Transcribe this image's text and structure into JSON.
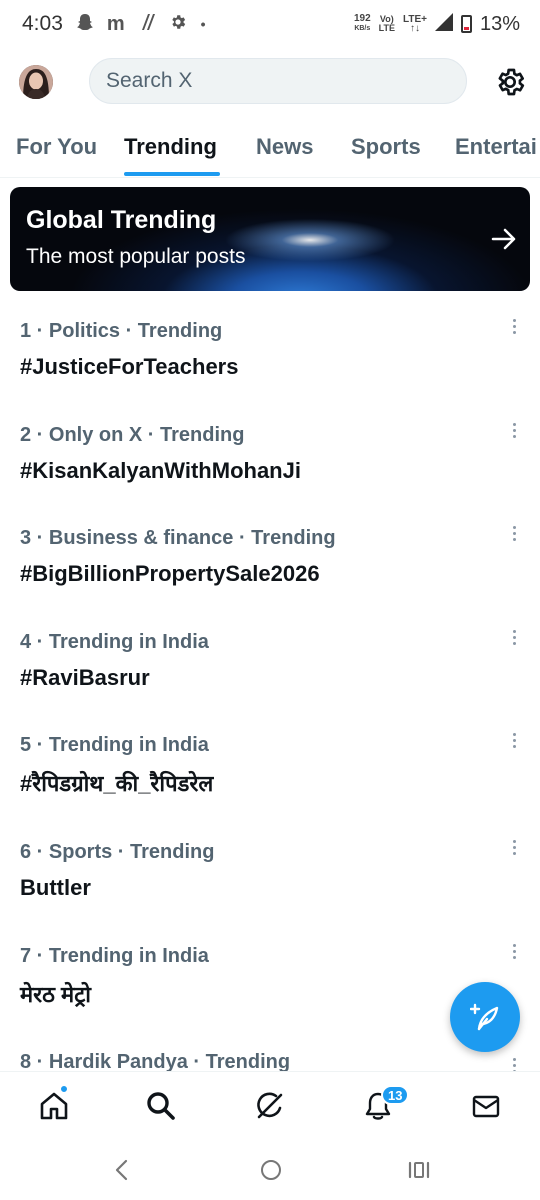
{
  "status_bar": {
    "time": "4:03",
    "notif_icons": [
      "snapchat-icon",
      "gmail-icon",
      "signal-icon",
      "settings-icon",
      "dot-icon"
    ],
    "speed_value": "192",
    "speed_unit": "KB/s",
    "volte_top": "Vo)",
    "volte_bottom": "LTE",
    "network_top": "LTE+",
    "network_bottom": "↑↓",
    "battery": "13%"
  },
  "header": {
    "search_placeholder": "Search X"
  },
  "tabs": [
    {
      "label": "For You",
      "active": false
    },
    {
      "label": "Trending",
      "active": true
    },
    {
      "label": "News",
      "active": false
    },
    {
      "label": "Sports",
      "active": false
    },
    {
      "label": "Entertai",
      "active": false
    }
  ],
  "banner": {
    "title": "Global Trending",
    "subtitle": "The most popular posts"
  },
  "trends": [
    {
      "meta": "1 · Politics · Trending",
      "name": "#JusticeForTeachers"
    },
    {
      "meta": "2 · Only on X · Trending",
      "name": "#KisanKalyanWithMohanJi"
    },
    {
      "meta": "3 · Business & finance · Trending",
      "name": "#BigBillionPropertySale2026"
    },
    {
      "meta": "4 · Trending in India",
      "name": "#RaviBasrur"
    },
    {
      "meta": "5 · Trending in India",
      "name": "#रैपिडग्रोथ_की_रैपिडरेल"
    },
    {
      "meta": "6 · Sports · Trending",
      "name": "Buttler"
    },
    {
      "meta": "7 · Trending in India",
      "name": "मेरठ मेट्रो"
    },
    {
      "meta": "8 · Hardik Pandya · Trending",
      "name": ""
    }
  ],
  "bottom_nav": {
    "items": [
      "home-icon",
      "search-icon",
      "grok-icon",
      "bell-icon",
      "mail-icon"
    ],
    "notification_count": "13"
  },
  "colors": {
    "accent": "#1d9bf0",
    "text_primary": "#0f1419",
    "text_secondary": "#536471"
  }
}
